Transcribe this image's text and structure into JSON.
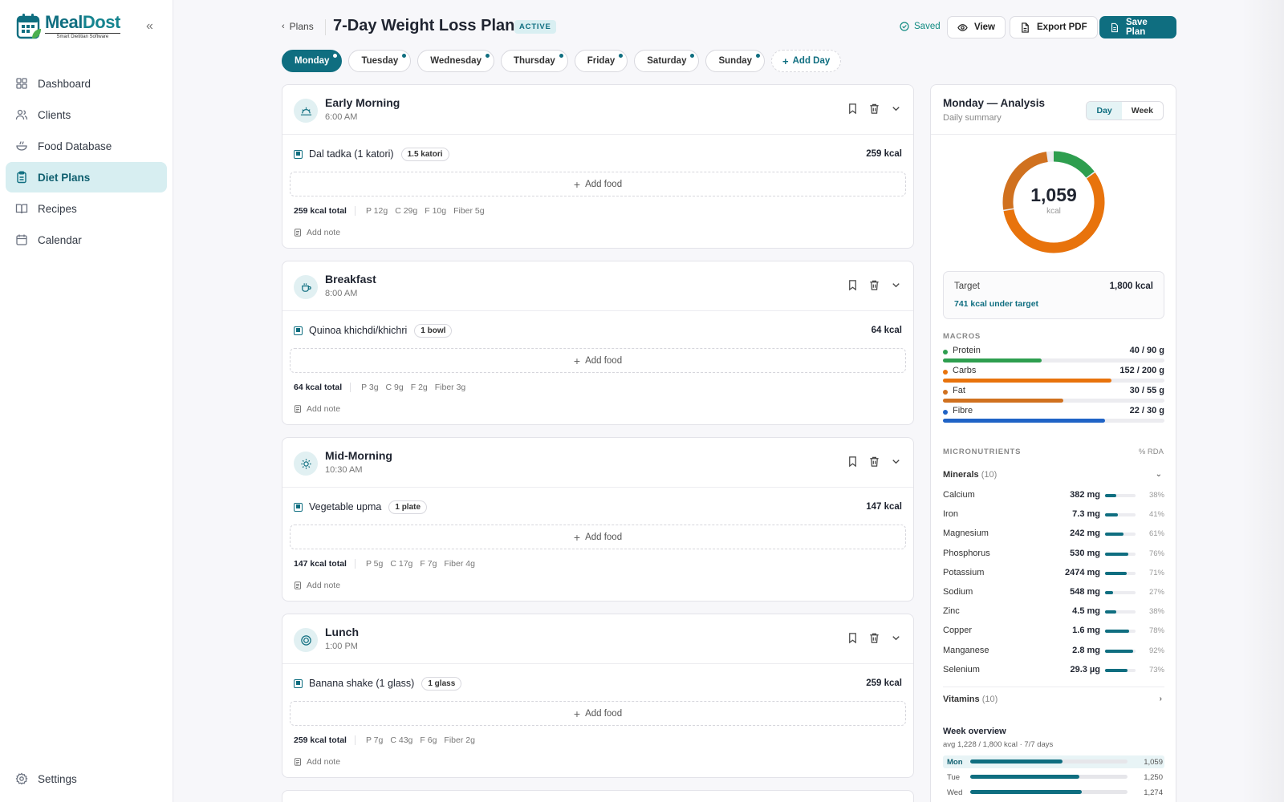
{
  "brand": {
    "name_a": "Meal",
    "name_b": "Dost",
    "tagline": "Smart Dietitian Software"
  },
  "sidebar": {
    "items": [
      {
        "label": "Dashboard",
        "icon": "grid-icon"
      },
      {
        "label": "Clients",
        "icon": "users-icon"
      },
      {
        "label": "Food Database",
        "icon": "bowl-icon"
      },
      {
        "label": "Diet Plans",
        "icon": "clipboard-icon",
        "active": true
      },
      {
        "label": "Recipes",
        "icon": "book-icon"
      },
      {
        "label": "Calendar",
        "icon": "calendar-icon"
      }
    ],
    "settings_label": "Settings"
  },
  "header": {
    "back_label": "Plans",
    "title": "7-Day Weight Loss Plan",
    "status": "ACTIVE",
    "saved_label": "Saved",
    "view_label": "View",
    "export_label": "Export PDF",
    "save_label": "Save Plan"
  },
  "days": [
    "Monday",
    "Tuesday",
    "Wednesday",
    "Thursday",
    "Friday",
    "Saturday",
    "Sunday"
  ],
  "add_day_label": "Add Day",
  "meals": [
    {
      "name": "Early Morning",
      "time": "6:00 AM",
      "food": "Dal tadka (1 katori)",
      "qty": "1.5 katori",
      "kcal": "259 kcal",
      "total": "259 kcal total",
      "p": "P 12g",
      "c": "C 29g",
      "f": "F 10g",
      "fiber": "Fiber 5g"
    },
    {
      "name": "Breakfast",
      "time": "8:00 AM",
      "food": "Quinoa khichdi/khichri",
      "qty": "1 bowl",
      "kcal": "64 kcal",
      "total": "64 kcal total",
      "p": "P 3g",
      "c": "C 9g",
      "f": "F 2g",
      "fiber": "Fiber 3g"
    },
    {
      "name": "Mid-Morning",
      "time": "10:30 AM",
      "food": "Vegetable upma",
      "qty": "1 plate",
      "kcal": "147 kcal",
      "total": "147 kcal total",
      "p": "P 5g",
      "c": "C 17g",
      "f": "F 7g",
      "fiber": "Fiber 4g"
    },
    {
      "name": "Lunch",
      "time": "1:00 PM",
      "food": "Banana shake (1 glass)",
      "qty": "1 glass",
      "kcal": "259 kcal",
      "total": "259 kcal total",
      "p": "P 7g",
      "c": "C 43g",
      "f": "F 6g",
      "fiber": "Fiber 2g"
    }
  ],
  "meal_labels": {
    "add_food": "Add food",
    "add_note": "Add note"
  },
  "analysis": {
    "title": "Monday — Analysis",
    "subtitle": "Daily summary",
    "seg_day": "Day",
    "seg_week": "Week",
    "total_kcal": "1,059",
    "kcal_unit": "kcal",
    "donut_shares": {
      "protein": 0.151,
      "carbs": 0.574,
      "fat": 0.255
    },
    "target_label": "Target",
    "target_value": "1,800 kcal",
    "under_label": "741 kcal under target",
    "macros_label": "MACROS",
    "macros": [
      {
        "name": "Protein",
        "amount": "40 / 90 g",
        "fraction": 0.444,
        "color": "#2e9e4f"
      },
      {
        "name": "Carbs",
        "amount": "152 / 200 g",
        "fraction": 0.76,
        "color": "#e8730c"
      },
      {
        "name": "Fat",
        "amount": "30 / 55 g",
        "fraction": 0.545,
        "color": "#d0711f"
      },
      {
        "name": "Fibre",
        "amount": "22 / 30 g",
        "fraction": 0.733,
        "color": "#1f63c6"
      }
    ],
    "micro_label": "MICRONUTRIENTS",
    "rda_label": "% RDA",
    "minerals_label": "Minerals",
    "minerals_count": "(10)",
    "minerals": [
      {
        "name": "Calcium",
        "amount": "382 mg",
        "pct": "38%",
        "fraction": 0.38
      },
      {
        "name": "Iron",
        "amount": "7.3 mg",
        "pct": "41%",
        "fraction": 0.41
      },
      {
        "name": "Magnesium",
        "amount": "242 mg",
        "pct": "61%",
        "fraction": 0.61
      },
      {
        "name": "Phosphorus",
        "amount": "530 mg",
        "pct": "76%",
        "fraction": 0.76
      },
      {
        "name": "Potassium",
        "amount": "2474 mg",
        "pct": "71%",
        "fraction": 0.71
      },
      {
        "name": "Sodium",
        "amount": "548 mg",
        "pct": "27%",
        "fraction": 0.27
      },
      {
        "name": "Zinc",
        "amount": "4.5 mg",
        "pct": "38%",
        "fraction": 0.38
      },
      {
        "name": "Copper",
        "amount": "1.6 mg",
        "pct": "78%",
        "fraction": 0.78
      },
      {
        "name": "Manganese",
        "amount": "2.8 mg",
        "pct": "92%",
        "fraction": 0.92
      },
      {
        "name": "Selenium",
        "amount": "29.3 µg",
        "pct": "73%",
        "fraction": 0.73
      }
    ],
    "vitamins_label": "Vitamins",
    "vitamins_count": "(10)",
    "week_title": "Week overview",
    "week_sub": "avg 1,228 / 1,800 kcal · 7/7 days",
    "week": [
      {
        "day": "Mon",
        "kcal": "1,059",
        "fraction": 0.588
      },
      {
        "day": "Tue",
        "kcal": "1,250",
        "fraction": 0.694
      },
      {
        "day": "Wed",
        "kcal": "1,274",
        "fraction": 0.708
      }
    ]
  }
}
